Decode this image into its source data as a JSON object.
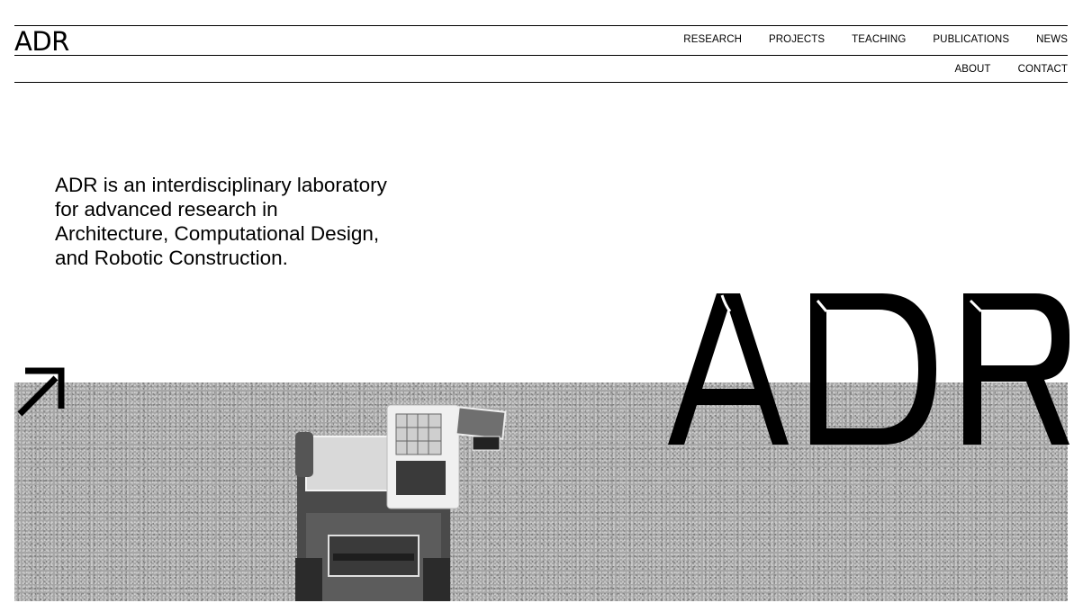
{
  "header": {
    "logo": "ADR",
    "nav_main": [
      "RESEARCH",
      "PROJECTS",
      "TEACHING",
      "PUBLICATIONS",
      "NEWS"
    ],
    "nav_secondary": [
      "ABOUT",
      "CONTACT"
    ]
  },
  "intro": {
    "text": "ADR is an interdisciplinary laboratory for advanced research in Architecture, Computational Design, and Robotic Construction."
  },
  "hero": {
    "big_logo": "ADR",
    "arrow_icon": "arrow-up-right-icon",
    "image": "aerial photo of robotic construction vehicle on gravel"
  },
  "colors": {
    "text": "#000000",
    "background": "#ffffff",
    "hero_gray": "#a6a6a6"
  }
}
